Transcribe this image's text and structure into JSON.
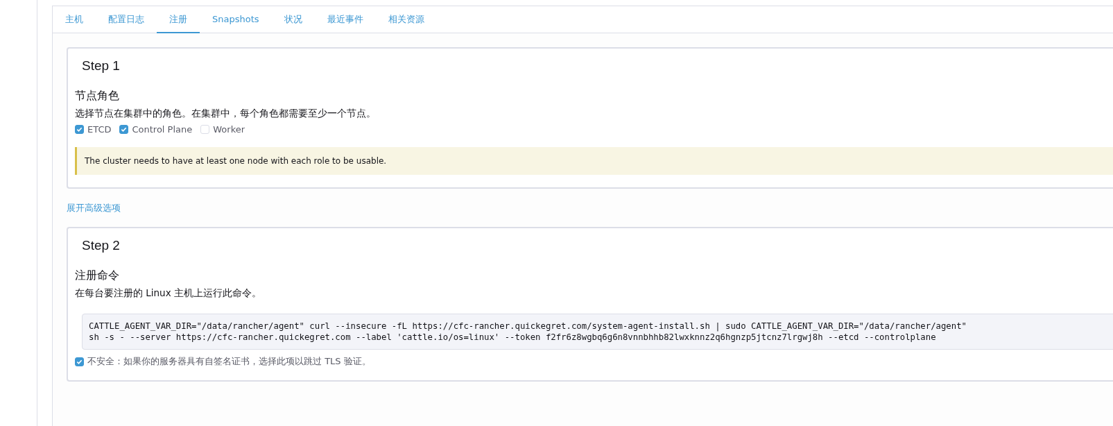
{
  "tabs": [
    {
      "label": "主机",
      "selected": false
    },
    {
      "label": "配置日志",
      "selected": false
    },
    {
      "label": "注册",
      "selected": true
    },
    {
      "label": "Snapshots",
      "selected": false
    },
    {
      "label": "状况",
      "selected": false
    },
    {
      "label": "最近事件",
      "selected": false
    },
    {
      "label": "相关资源",
      "selected": false
    }
  ],
  "step1": {
    "title": "Step 1",
    "heading": "节点角色",
    "description": "选择节点在集群中的角色。在集群中，每个角色都需要至少一个节点。",
    "roles": [
      {
        "label": "ETCD",
        "checked": true
      },
      {
        "label": "Control Plane",
        "checked": true
      },
      {
        "label": "Worker",
        "checked": false
      }
    ],
    "notice": "The cluster needs to have at least one node with each role to be usable."
  },
  "advanced_link": "展开高级选项",
  "step2": {
    "title": "Step 2",
    "heading": "注册命令",
    "description": "在每台要注册的 Linux 主机上运行此命令。",
    "command_lines": [
      "CATTLE_AGENT_VAR_DIR=\"/data/rancher/agent\" curl --insecure -fL https://cfc-rancher.quickegret.com/system-agent-install.sh | sudo CATTLE_AGENT_VAR_DIR=\"/data/rancher/agent\"",
      "sh -s - --server https://cfc-rancher.quickegret.com --label 'cattle.io/os=linux' --token f2fr6z8wgbq6g6n8vnnbhhb82lwxknnz2q6hgnzp5jtcnz7lrgwj8h --etcd --controlplane"
    ],
    "insecure": {
      "label": "不安全：如果你的服务器具有自签名证书，选择此项以跳过 TLS 验证。",
      "checked": true
    }
  }
}
